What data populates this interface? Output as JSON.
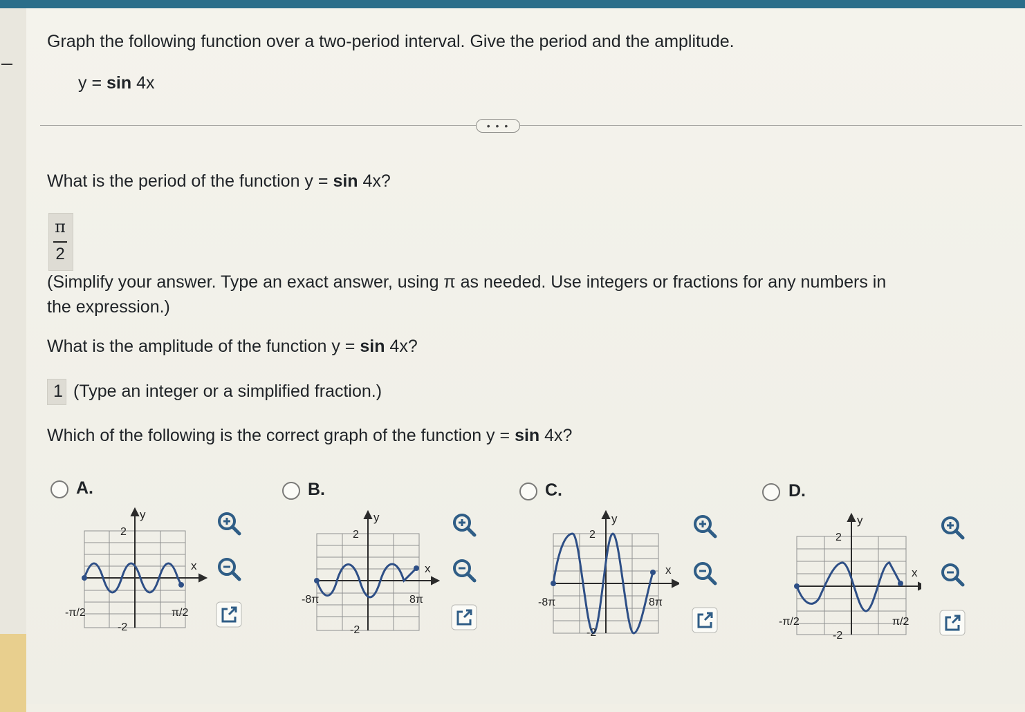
{
  "question": {
    "instruction": "Graph the following function over a two-period interval. Give the period and the amplitude.",
    "function": {
      "lhs": "y =",
      "func": "sin",
      "arg": "4x"
    }
  },
  "more_button_label": "• • •",
  "period": {
    "question_prefix": "What is the period of the function y =",
    "question_func": "sin",
    "question_suffix": "4x?",
    "answer": {
      "numerator": "π",
      "denominator": "2"
    },
    "hint_line1": "(Simplify your answer. Type an exact answer, using π as needed. Use integers or fractions for any numbers in",
    "hint_line2": "the expression.)"
  },
  "amplitude": {
    "question_prefix": "What is the amplitude of the function y =",
    "question_func": "sin",
    "question_suffix": "4x?",
    "answer": "1",
    "hint": "(Type an integer or a simplified fraction.)"
  },
  "graph_question": {
    "prefix": "Which of the following is the correct graph of the function y =",
    "func": "sin",
    "suffix": "4x?"
  },
  "choices": [
    {
      "letter": "A.",
      "selected": false,
      "y_axis_label": "y",
      "x_axis_label": "x",
      "y_max_label": "2",
      "y_min_label": "-2",
      "x_min_label": "-π/2",
      "x_max_label": "π/2",
      "wave": "sin 4x, amplitude 1, x from -π/2 to π/2"
    },
    {
      "letter": "B.",
      "selected": false,
      "y_axis_label": "y",
      "x_axis_label": "x",
      "y_max_label": "2",
      "y_min_label": "-2",
      "x_min_label": "-8π",
      "x_max_label": "8π",
      "wave": "amplitude 1, x from -8π to 8π"
    },
    {
      "letter": "C.",
      "selected": false,
      "y_axis_label": "y",
      "x_axis_label": "x",
      "y_max_label": "2",
      "y_min_label": "-2",
      "x_min_label": "-8π",
      "x_max_label": "8π",
      "wave": "amplitude 2, x from -8π to 8π"
    },
    {
      "letter": "D.",
      "selected": false,
      "y_axis_label": "y",
      "x_axis_label": "x",
      "y_max_label": "2",
      "y_min_label": "-2",
      "x_min_label": "-π/2",
      "x_max_label": "π/2",
      "wave": "amplitude 1, x from -π/2 to π/2"
    }
  ],
  "tools": {
    "zoom_in": "zoom-in-icon",
    "zoom_out": "zoom-out-icon",
    "popout": "external-link-icon"
  },
  "colors": {
    "curve": "#2e4f86",
    "grid": "#8f9090",
    "axis": "#2b2b2b",
    "header": "#2b6e8a",
    "tool_icon": "#2f5d86"
  }
}
